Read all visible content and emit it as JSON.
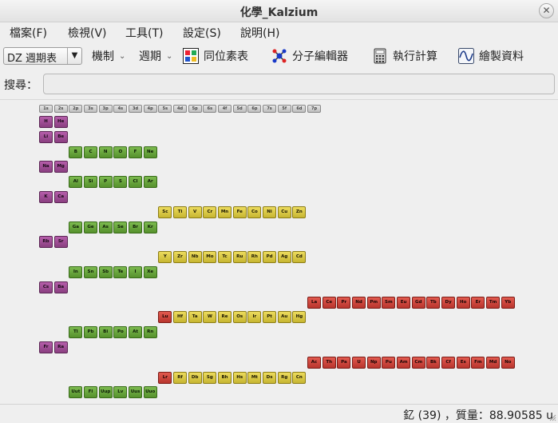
{
  "window": {
    "title": "化學_Kalzium",
    "close_glyph": "✕"
  },
  "menu": [
    "檔案(F)",
    "檢視(V)",
    "工具(T)",
    "設定(S)",
    "說明(H)"
  ],
  "toolbar": {
    "table_combo": "DZ 週期表",
    "mechanism": "機制",
    "period": "週期",
    "isotope": "同位素表",
    "molecule": "分子編輯器",
    "calculate": "執行計算",
    "plot": "繪製資料"
  },
  "search": {
    "label": "搜尋：",
    "value": ""
  },
  "group_labels": [
    "1s",
    "2s",
    "2p",
    "3s",
    "3p",
    "4s",
    "3d",
    "4p",
    "5s",
    "4d",
    "5p",
    "6s",
    "4f",
    "5d",
    "6p",
    "7s",
    "5f",
    "6d",
    "7p"
  ],
  "rows": [
    {
      "block": "s",
      "col": 0,
      "elements": [
        "H",
        "He"
      ]
    },
    {
      "block": "s",
      "col": 0,
      "elements": [
        "Li",
        "Be"
      ]
    },
    {
      "block": "p",
      "col": 2,
      "elements": [
        "B",
        "C",
        "N",
        "O",
        "F",
        "Ne"
      ]
    },
    {
      "block": "s",
      "col": 0,
      "elements": [
        "Na",
        "Mg"
      ]
    },
    {
      "block": "p",
      "col": 2,
      "elements": [
        "Al",
        "Si",
        "P",
        "S",
        "Cl",
        "Ar"
      ]
    },
    {
      "block": "s",
      "col": 0,
      "elements": [
        "K",
        "Ca"
      ]
    },
    {
      "block": "d",
      "col": 8,
      "elements": [
        "Sc",
        "Ti",
        "V",
        "Cr",
        "Mn",
        "Fe",
        "Co",
        "Ni",
        "Cu",
        "Zn"
      ]
    },
    {
      "block": "p",
      "col": 2,
      "elements": [
        "Ga",
        "Ge",
        "As",
        "Se",
        "Br",
        "Kr"
      ]
    },
    {
      "block": "s",
      "col": 0,
      "elements": [
        "Rb",
        "Sr"
      ]
    },
    {
      "block": "d",
      "col": 8,
      "elements": [
        "Y",
        "Zr",
        "Nb",
        "Mo",
        "Tc",
        "Ru",
        "Rh",
        "Pd",
        "Ag",
        "Cd"
      ]
    },
    {
      "block": "p",
      "col": 2,
      "elements": [
        "In",
        "Sn",
        "Sb",
        "Te",
        "I",
        "Xe"
      ]
    },
    {
      "block": "s",
      "col": 0,
      "elements": [
        "Cs",
        "Ba"
      ]
    },
    {
      "block": "f",
      "col": 18,
      "elements": [
        "La",
        "Ce",
        "Pr",
        "Nd",
        "Pm",
        "Sm",
        "Eu",
        "Gd",
        "Tb",
        "Dy",
        "Ho",
        "Er",
        "Tm",
        "Yb"
      ]
    },
    {
      "block": "mixed",
      "col": 8,
      "elements": [
        "Lu",
        "Hf",
        "Ta",
        "W",
        "Re",
        "Os",
        "Ir",
        "Pt",
        "Au",
        "Hg"
      ]
    },
    {
      "block": "p",
      "col": 2,
      "elements": [
        "Tl",
        "Pb",
        "Bi",
        "Po",
        "At",
        "Rn"
      ]
    },
    {
      "block": "s",
      "col": 0,
      "elements": [
        "Fr",
        "Ra"
      ]
    },
    {
      "block": "f",
      "col": 18,
      "elements": [
        "Ac",
        "Th",
        "Pa",
        "U",
        "Np",
        "Pu",
        "Am",
        "Cm",
        "Bk",
        "Cf",
        "Es",
        "Fm",
        "Md",
        "No"
      ]
    },
    {
      "block": "mixed",
      "col": 8,
      "elements": [
        "Lr",
        "Rf",
        "Db",
        "Sg",
        "Bh",
        "Hs",
        "Mt",
        "Ds",
        "Rg",
        "Cn"
      ]
    },
    {
      "block": "p",
      "col": 2,
      "elements": [
        "Uut",
        "Fl",
        "Uup",
        "Lv",
        "Uus",
        "Uuo"
      ]
    }
  ],
  "status": "釔 (39) ，質量：88.90585 u",
  "colors": {
    "s": "#9b4a90",
    "p": "#6aa63e",
    "d": "#d9c847",
    "f": "#cc453c",
    "group": "#d0d0d0"
  }
}
